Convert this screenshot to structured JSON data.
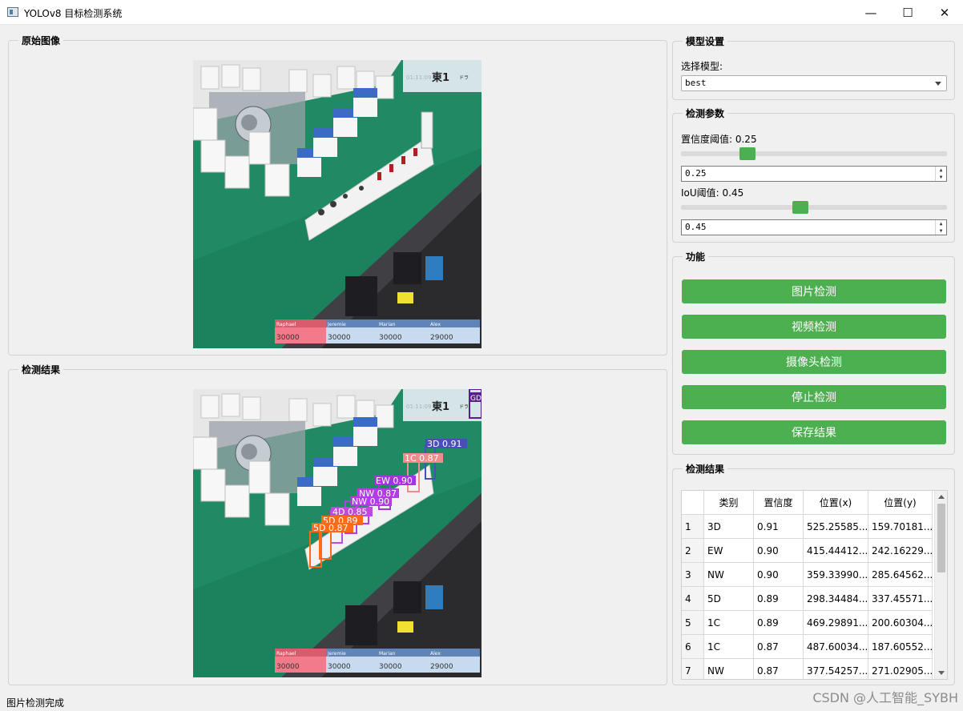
{
  "window": {
    "title": "YOLOv8 目标检测系统",
    "minimize": "—",
    "maximize": "☐",
    "close": "✕"
  },
  "original": {
    "title": "原始图像",
    "scoreboard": {
      "round": "東1",
      "time": "01:11:09",
      "dora": "ドラ"
    },
    "players": [
      {
        "name": "Raphael",
        "score": "30000",
        "color": "#f27a8a"
      },
      {
        "name": "Jeremie",
        "score": "30000",
        "color": "#c8daf0"
      },
      {
        "name": "Marian",
        "score": "30000",
        "color": "#c8daf0"
      },
      {
        "name": "Alex",
        "score": "29000",
        "color": "#c8daf0"
      }
    ]
  },
  "result_image": {
    "title": "检测结果",
    "detections": [
      {
        "label": "3D 0.91",
        "color": "#4a4fb8"
      },
      {
        "label": "1C 0.87",
        "color": "#f28b8b"
      },
      {
        "label": "EW 0.90",
        "color": "#a633e0"
      },
      {
        "label": "NW 0.87",
        "color": "#b23ce6"
      },
      {
        "label": "NW 0.90",
        "color": "#b23ce6"
      },
      {
        "label": "4D 0.85",
        "color": "#c04adb"
      },
      {
        "label": "5D 0.89",
        "color": "#ff6a1a"
      },
      {
        "label": "5D 0.87",
        "color": "#ff6a1a"
      },
      {
        "label": "GD",
        "color": "#5a1e8c"
      }
    ]
  },
  "model_settings": {
    "title": "模型设置",
    "select_label": "选择模型:",
    "selected_model": "best"
  },
  "detect_params": {
    "title": "检测参数",
    "confidence_label": "置信度阈值: 0.25",
    "confidence_value": "0.25",
    "confidence_fraction": 0.25,
    "iou_label": "IoU阈值: 0.45",
    "iou_value": "0.45",
    "iou_fraction": 0.45
  },
  "functions": {
    "title": "功能",
    "buttons": [
      "图片检测",
      "视频检测",
      "摄像头检测",
      "停止检测",
      "保存结果"
    ],
    "button_color": "#4caf50"
  },
  "results_table": {
    "title": "检测结果",
    "columns": [
      "类别",
      "置信度",
      "位置(x)",
      "位置(y)"
    ],
    "rows": [
      {
        "index": "1",
        "cls": "3D",
        "conf": "0.91",
        "x": "525.25585...",
        "y": "159.70181..."
      },
      {
        "index": "2",
        "cls": "EW",
        "conf": "0.90",
        "x": "415.44412...",
        "y": "242.16229..."
      },
      {
        "index": "3",
        "cls": "NW",
        "conf": "0.90",
        "x": "359.33990...",
        "y": "285.64562..."
      },
      {
        "index": "4",
        "cls": "5D",
        "conf": "0.89",
        "x": "298.34484...",
        "y": "337.45571..."
      },
      {
        "index": "5",
        "cls": "1C",
        "conf": "0.89",
        "x": "469.29891...",
        "y": "200.60304..."
      },
      {
        "index": "6",
        "cls": "1C",
        "conf": "0.87",
        "x": "487.60034...",
        "y": "187.60552..."
      },
      {
        "index": "7",
        "cls": "NW",
        "conf": "0.87",
        "x": "377.54257...",
        "y": "271.02905..."
      }
    ]
  },
  "status_bar": {
    "message": "图片检测完成"
  },
  "watermark": "CSDN @人工智能_SYBH"
}
